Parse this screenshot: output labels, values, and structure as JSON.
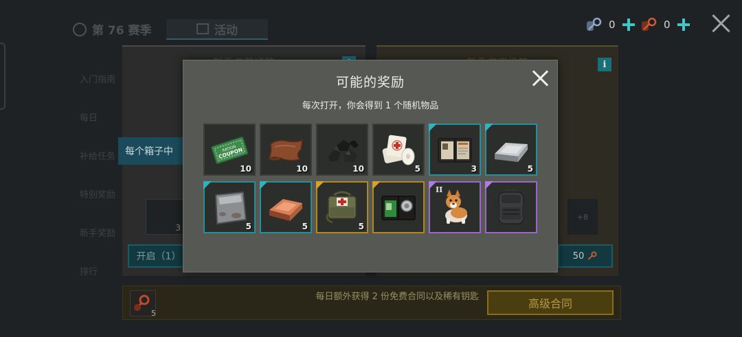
{
  "background": {
    "season_tab_label": "第 76 赛季",
    "event_tab_label": "活动",
    "side_items": [
      "入门指南",
      "每日",
      "补给任务",
      "特别奖励",
      "新手奖励",
      "排行"
    ],
    "left_box_title": "新手者普通箱",
    "right_box_title": "新手者高级箱",
    "per_box_label": "每个箱子中",
    "left_preview_qty": "3",
    "right_more_label": "+8",
    "open_left_label": "开启（1）",
    "open_right_cost": "50",
    "bottom_key_qty": "5",
    "bottom_text": "每日额外获得 2 份免费合同以及稀有钥匙",
    "premium_button_label": "高级合同"
  },
  "resources": [
    {
      "name": "common-key",
      "count": "0",
      "color": "#6d8fb8"
    },
    {
      "name": "rare-key",
      "count": "0",
      "color": "#b04a2c"
    }
  ],
  "modal": {
    "title": "可能的奖励",
    "subtitle": "每次打开，你会得到 1 个随机物品"
  },
  "rewards": [
    {
      "icon": "ration-coupon",
      "qty": "10",
      "rarity": "common"
    },
    {
      "icon": "leather",
      "qty": "10",
      "rarity": "common"
    },
    {
      "icon": "coal",
      "qty": "10",
      "rarity": "common"
    },
    {
      "icon": "bandage",
      "qty": "5",
      "rarity": "common"
    },
    {
      "icon": "document-folder",
      "qty": "3",
      "rarity": "uncommon"
    },
    {
      "icon": "iron-ingot",
      "qty": "5",
      "rarity": "uncommon"
    },
    {
      "icon": "steel-plate",
      "qty": "5",
      "rarity": "uncommon"
    },
    {
      "icon": "copper-ingot",
      "qty": "5",
      "rarity": "uncommon"
    },
    {
      "icon": "medical-bag",
      "qty": "5",
      "rarity": "rare"
    },
    {
      "icon": "police-badge-wallet",
      "qty": "",
      "rarity": "rare"
    },
    {
      "icon": "corgi-pet",
      "qty": "",
      "rarity": "epic",
      "tier": "II"
    },
    {
      "icon": "tactical-backpack",
      "qty": "",
      "rarity": "epic"
    }
  ],
  "colors": {
    "accent_teal": "#3ec8c8",
    "uncommon": "#2a8e97",
    "rare": "#b4881c",
    "epic": "#9a66c8",
    "modal_bg": "#555853"
  }
}
